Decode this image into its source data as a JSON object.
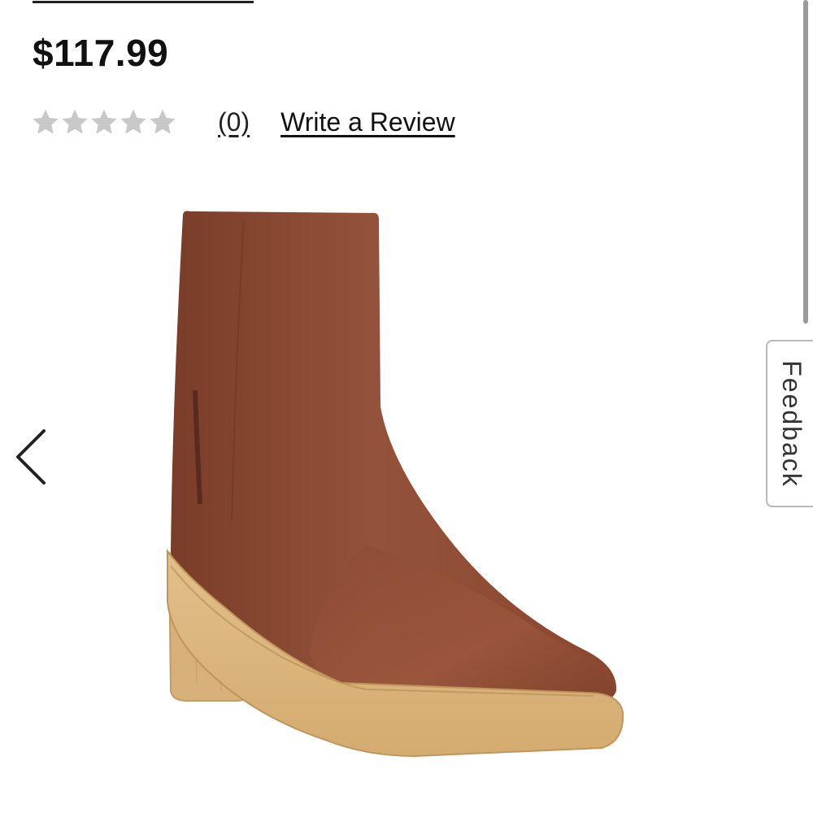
{
  "product": {
    "price": "$117.99",
    "rating": {
      "stars_filled": 0,
      "stars_total": 5,
      "count_label": "(0)",
      "write_review_label": "Write a Review"
    },
    "image": {
      "subject": "boot-icon",
      "upper_color": "#8a4a33",
      "sole_color": "#d9b27a"
    }
  },
  "carousel": {
    "prev_icon": "chevron-left-icon"
  },
  "feedback_tab": {
    "label": "Feedback"
  },
  "colors": {
    "star_empty": "#c8c8c8",
    "text": "#111111"
  }
}
